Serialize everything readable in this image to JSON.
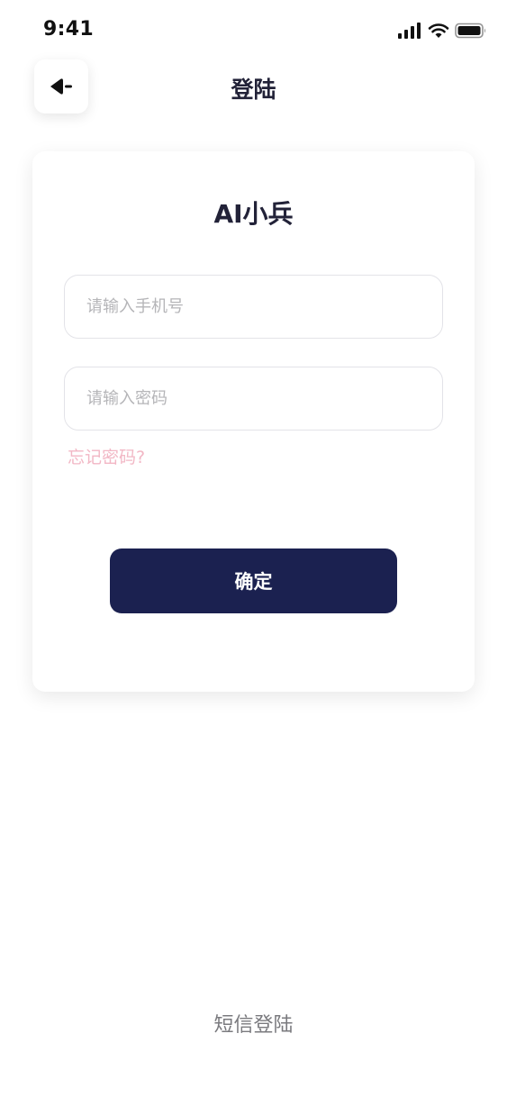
{
  "status_bar": {
    "time": "9:41"
  },
  "header": {
    "title": "登陆",
    "back_icon": "back-arrow-icon"
  },
  "card": {
    "title": "AI小兵",
    "phone_input": {
      "placeholder": "请输入手机号",
      "value": ""
    },
    "password_input": {
      "placeholder": "请输入密码",
      "value": ""
    },
    "forgot_link": "忘记密码?",
    "confirm_label": "确定"
  },
  "footer": {
    "sms_login": "短信登陆"
  },
  "colors": {
    "primary": "#1b2150",
    "title_text": "#222238",
    "forgot_link": "#f2b7c5",
    "placeholder": "#b5b5b8",
    "footer_text": "#7a7a7e"
  }
}
